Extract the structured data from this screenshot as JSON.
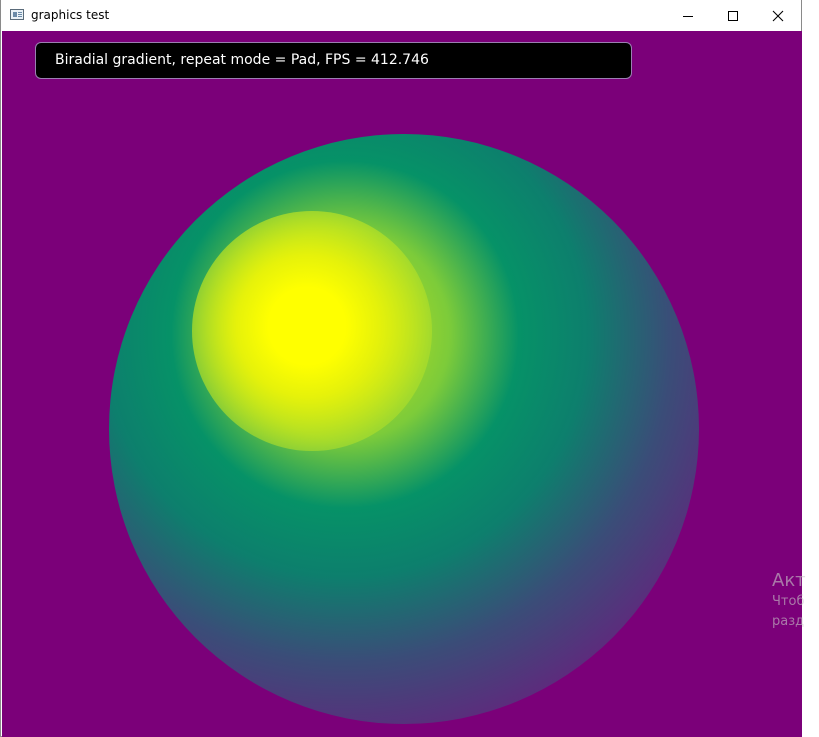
{
  "window": {
    "title": "graphics test",
    "controls": [
      "minimize",
      "maximize",
      "close"
    ]
  },
  "hud": {
    "text": "Biradial gradient, repeat mode = Pad, FPS = 412.746"
  },
  "canvas": {
    "background_color": "#7b0079",
    "gradient_colors": [
      "#ffff00",
      "#069267",
      "#7b0079"
    ]
  },
  "watermark": {
    "line1": "Акт",
    "line2": "Чтоб",
    "line3": "разд"
  }
}
